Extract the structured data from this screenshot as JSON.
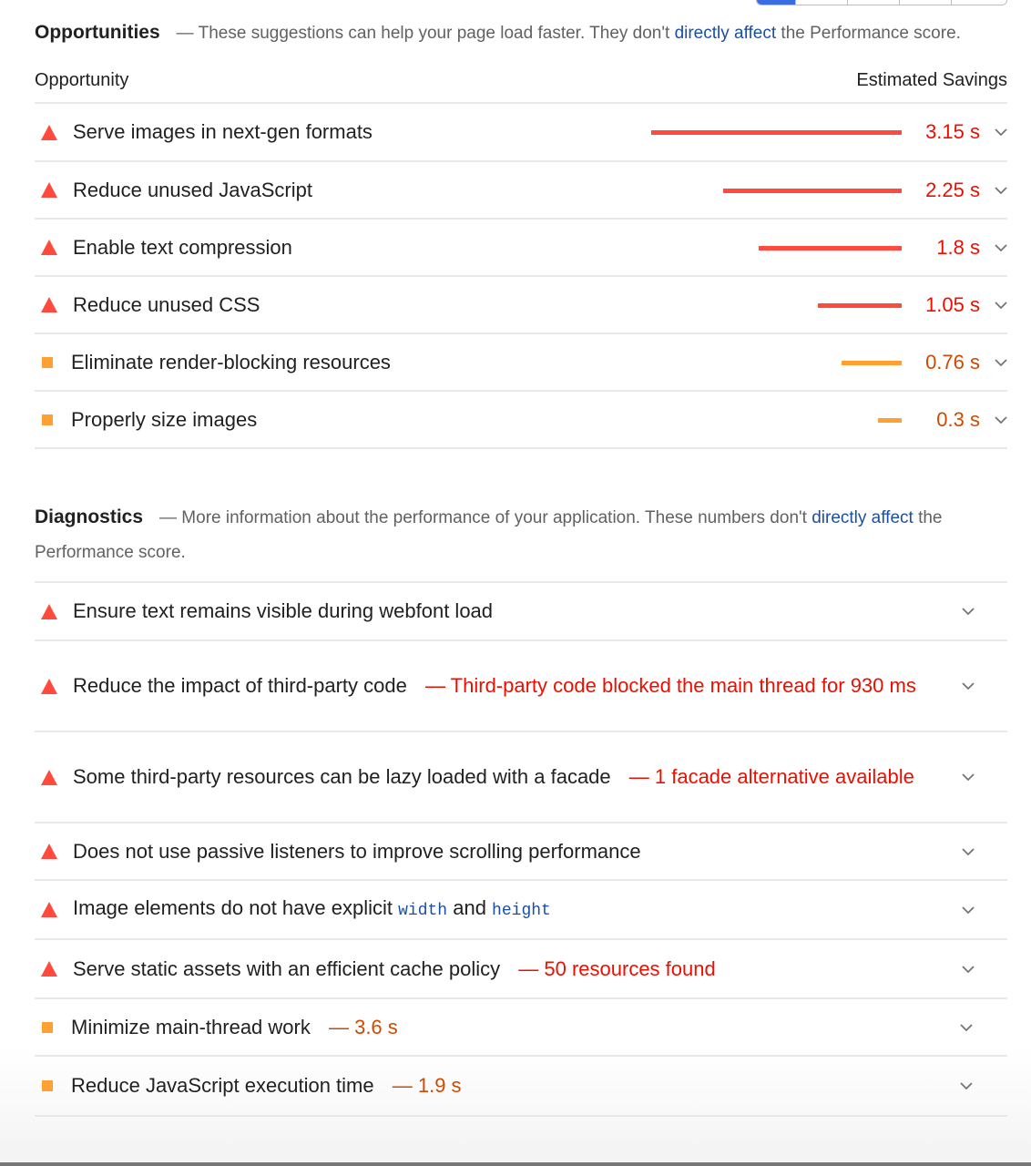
{
  "opportunities": {
    "title": "Opportunities",
    "desc_prefix": "— These suggestions can help your page load faster. They don't ",
    "desc_link": "directly affect",
    "desc_suffix": " the Performance score.",
    "col_left": "Opportunity",
    "col_right": "Estimated Savings",
    "max_savings_s": 3.15,
    "items": [
      {
        "label": "Serve images in next-gen formats",
        "savings": "3.15 s",
        "savings_s": 3.15,
        "severity": "fail",
        "icon": "red-triangle-icon"
      },
      {
        "label": "Reduce unused JavaScript",
        "savings": "2.25 s",
        "savings_s": 2.25,
        "severity": "fail",
        "icon": "red-triangle-icon"
      },
      {
        "label": "Enable text compression",
        "savings": "1.8 s",
        "savings_s": 1.8,
        "severity": "fail",
        "icon": "red-triangle-icon"
      },
      {
        "label": "Reduce unused CSS",
        "savings": "1.05 s",
        "savings_s": 1.05,
        "severity": "fail",
        "icon": "red-triangle-icon"
      },
      {
        "label": "Eliminate render-blocking resources",
        "savings": "0.76 s",
        "savings_s": 0.76,
        "severity": "average",
        "icon": "orange-square-icon"
      },
      {
        "label": "Properly size images",
        "savings": "0.3 s",
        "savings_s": 0.3,
        "severity": "average",
        "icon": "orange-square-icon"
      }
    ]
  },
  "diagnostics": {
    "title": "Diagnostics",
    "desc_prefix": "— More information about the performance of your application. These numbers don't ",
    "desc_link": "directly affect",
    "desc_suffix": " the Performance score.",
    "items": [
      {
        "label": "Ensure text remains visible during webfont load",
        "detail": "",
        "severity": "fail"
      },
      {
        "label": "Reduce the impact of third-party code",
        "detail": "— Third-party code blocked the main thread for 930 ms",
        "severity": "fail"
      },
      {
        "label": "Some third-party resources can be lazy loaded with a facade",
        "detail": "— 1 facade alternative available",
        "severity": "fail"
      },
      {
        "label": "Does not use passive listeners to improve scrolling performance",
        "detail": "",
        "severity": "fail"
      },
      {
        "label_parts": [
          "Image elements do not have explicit ",
          "width",
          " and ",
          "height"
        ],
        "severity": "fail"
      },
      {
        "label": "Serve static assets with an efficient cache policy",
        "detail": "— 50 resources found",
        "severity": "fail"
      },
      {
        "label": "Minimize main-thread work",
        "detail": "— 3.6 s",
        "severity": "average"
      },
      {
        "label": "Reduce JavaScript execution time",
        "detail": "— 1.9 s",
        "severity": "average"
      }
    ]
  },
  "colors": {
    "fail": "#ff4a3d",
    "fail_text": "#eb0f00",
    "average": "#ffa033",
    "average_text": "#d04900",
    "link": "#1a4fa3"
  }
}
